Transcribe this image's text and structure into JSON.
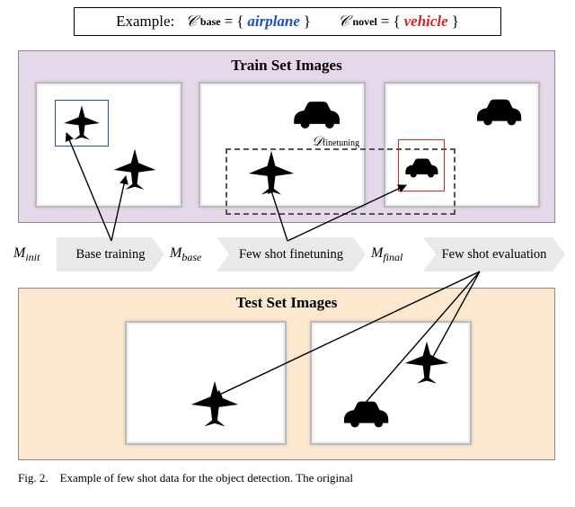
{
  "example": {
    "prefix": "Example:",
    "cbase_sym": "𝒞",
    "cbase_sub": "base",
    "eq": "=",
    "lb": "{",
    "rb": "}",
    "airplane": "airplane",
    "cnovel_sym": "𝒞",
    "cnovel_sub": "novel",
    "vehicle": "vehicle"
  },
  "panels": {
    "train_title": "Train Set Images",
    "test_title": "Test Set Images"
  },
  "finetune": {
    "sym": "𝒟",
    "sub": "finetuning"
  },
  "pipeline": {
    "m_init": "M",
    "m_init_sub": "init",
    "step1": "Base training",
    "m_base": "M",
    "m_base_sub": "base",
    "step2": "Few shot finetuning",
    "m_final": "M",
    "m_final_sub": "final",
    "step3": "Few shot evaluation"
  },
  "caption": {
    "fig": "Fig. 2.",
    "text": "Example of few shot data for the object detection. The original"
  },
  "icons": {
    "airplane": "airplane-icon",
    "car": "car-icon"
  }
}
